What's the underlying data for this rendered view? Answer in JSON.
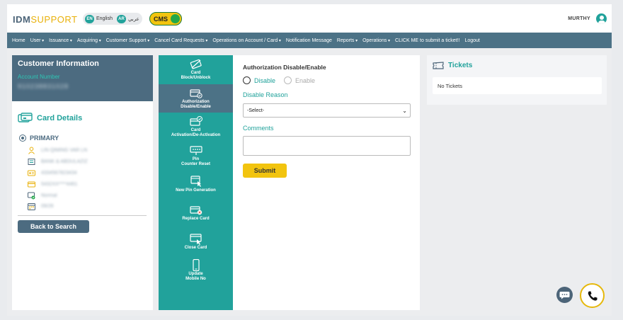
{
  "header": {
    "logo_part1": "IDM",
    "logo_part2": "SUPPORT",
    "lang_en_code": "EN",
    "lang_en_label": "English",
    "lang_ar_code": "AR",
    "lang_ar_label": "عربي",
    "cms_label": "CMS",
    "user_name": "MURTHY"
  },
  "nav": {
    "items": [
      {
        "label": "Home",
        "dropdown": false
      },
      {
        "label": "User",
        "dropdown": true
      },
      {
        "label": "Issuance",
        "dropdown": true
      },
      {
        "label": "Acquiring",
        "dropdown": true
      },
      {
        "label": "Customer Support",
        "dropdown": true
      },
      {
        "label": "Cancel Card Requests",
        "dropdown": true
      },
      {
        "label": "Operations on Account / Card",
        "dropdown": true
      },
      {
        "label": "Notification Message",
        "dropdown": false
      },
      {
        "label": "Reports",
        "dropdown": true
      },
      {
        "label": "Operations",
        "dropdown": true
      },
      {
        "label": "CLICK ME to submit a ticket!!",
        "dropdown": false
      },
      {
        "label": "Logout",
        "dropdown": false
      }
    ]
  },
  "customer": {
    "title": "Customer Information",
    "account_label": "Account Number",
    "account_value": "910238831028"
  },
  "card_details": {
    "title": "Card Details",
    "primary_label": "PRIMARY",
    "rows": [
      {
        "icon": "user-icon",
        "text": "LIN QIMING VAR LN"
      },
      {
        "icon": "bank-icon",
        "text": "BANK & ABDULAZIZ"
      },
      {
        "icon": "id-card-icon",
        "text": "4334567823434"
      },
      {
        "icon": "credit-card-icon",
        "text": "5432XX****4461"
      },
      {
        "icon": "status-icon",
        "text": "Normal"
      },
      {
        "icon": "calendar-icon",
        "text": "09/26"
      }
    ],
    "back_label": "Back to Search"
  },
  "menu": {
    "items": [
      {
        "name": "card-block-unblock",
        "label1": "Card",
        "label2": "Block/Unblock",
        "active": false
      },
      {
        "name": "authorization-disable-enable",
        "label1": "Authorization",
        "label2": "Disable/Enable",
        "active": true
      },
      {
        "name": "card-activation",
        "label1": "Card",
        "label2": "Activation/De-Activation",
        "active": false
      },
      {
        "name": "pin-counter-reset",
        "label1": "Pin",
        "label2": "Counter Reset",
        "active": false
      },
      {
        "name": "new-pin-generation",
        "label1": "New Pin Generation",
        "label2": "",
        "active": false
      },
      {
        "name": "replace-card",
        "label1": "Replace Card",
        "label2": "",
        "active": false
      },
      {
        "name": "close-card",
        "label1": "Close Card",
        "label2": "",
        "active": false
      },
      {
        "name": "update-mobile",
        "label1": "Update",
        "label2": "Mobile No",
        "active": false
      }
    ]
  },
  "form": {
    "title": "Authorization Disable/Enable",
    "radio_disable": "Disable",
    "radio_enable": "Enable",
    "reason_label": "Disable Reason",
    "reason_value": "-Select-",
    "comments_label": "Comments",
    "submit_label": "Submit"
  },
  "tickets": {
    "title": "Tickets",
    "empty_text": "No Tickets"
  },
  "colors": {
    "teal": "#21a29b",
    "slate": "#4c6b80",
    "nav": "#4c7286",
    "yellow": "#f2c40f"
  }
}
